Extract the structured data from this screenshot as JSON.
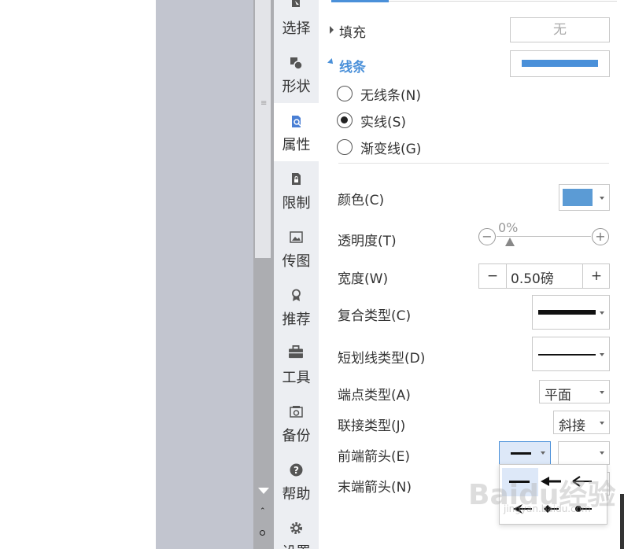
{
  "sidebar": {
    "items": [
      {
        "label": "选择",
        "icon": "cursor-icon"
      },
      {
        "label": "形状",
        "icon": "shapes-icon"
      },
      {
        "label": "属性",
        "icon": "properties-icon"
      },
      {
        "label": "限制",
        "icon": "lock-icon"
      },
      {
        "label": "传图",
        "icon": "image-icon"
      },
      {
        "label": "推荐",
        "icon": "badge-icon"
      },
      {
        "label": "工具",
        "icon": "toolbox-icon"
      },
      {
        "label": "备份",
        "icon": "backup-icon"
      },
      {
        "label": "帮助",
        "icon": "help-icon"
      },
      {
        "label": "设置",
        "icon": "gear-icon"
      }
    ],
    "active": "属性"
  },
  "fill": {
    "title": "填充",
    "value": "无"
  },
  "line": {
    "title": "线条",
    "color": "#4a90d9",
    "options": [
      {
        "label": "无线条(N)",
        "checked": false
      },
      {
        "label": "实线(S)",
        "checked": true
      },
      {
        "label": "渐变线(G)",
        "checked": false
      }
    ]
  },
  "props": {
    "color_label": "颜色(C)",
    "color_value": "#5b9bd5",
    "transparency_label": "透明度(T)",
    "transparency_value": "0%",
    "width_label": "宽度(W)",
    "width_value": "0.50磅",
    "compound_label": "复合类型(C)",
    "dash_label": "短划线类型(D)",
    "cap_label": "端点类型(A)",
    "cap_value": "平面",
    "join_label": "联接类型(J)",
    "join_value": "斜接",
    "begin_arrow_label": "前端箭头(E)",
    "end_arrow_label": "末端箭头(N)"
  },
  "stepper": {
    "minus": "−",
    "plus": "+"
  },
  "transparency": {
    "minus": "−",
    "plus": "+"
  },
  "watermark": {
    "text": "Baidu经验",
    "sub": "jingyan.baidu.com"
  }
}
